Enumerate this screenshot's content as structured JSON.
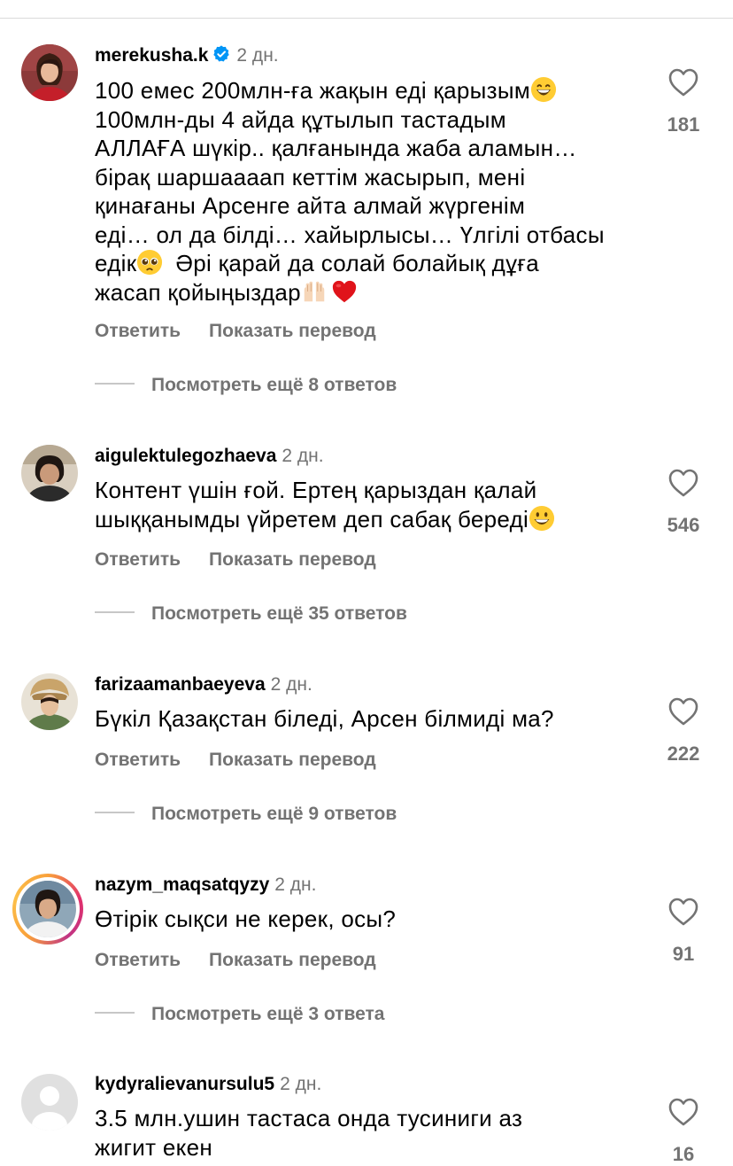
{
  "comments": [
    {
      "username": "merekusha.k",
      "verified": true,
      "time": "2 дн.",
      "lines": [
        "100 емес 200млн-ға жақын еді қарызым",
        "100млн-ды 4 айда құтылып тастадым",
        "АЛЛАҒА шүкір.. қалғанында жаба аламын…",
        "бірақ шаршаааап кеттім жасырып, мені",
        "қинағаны Арсенге айта алмай жүргенім",
        "еді… ол да білді… хайырлысы… Үлгілі отбасы",
        "едік",
        "Әрі қарай да солай болайық дұға",
        "жасап қойыңыздар"
      ],
      "emojis": [
        "grinning-face-with-smiling-eyes",
        "pleading-face",
        "raising-hands",
        "red-heart"
      ],
      "reply": "Ответить",
      "translate": "Показать перевод",
      "more_replies": "Посмотреть ещё 8 ответов",
      "likes": "181"
    },
    {
      "username": "aigulektulegozhaeva",
      "verified": false,
      "time": "2 дн.",
      "lines": [
        "Контент үшін ғой. Ертең қарыздан қалай",
        "шыққанымды үйретем деп сабақ береді"
      ],
      "emojis": [
        "grinning-face"
      ],
      "reply": "Ответить",
      "translate": "Показать перевод",
      "more_replies": "Посмотреть ещё 35 ответов",
      "likes": "546"
    },
    {
      "username": "farizaamanbaeyeva",
      "verified": false,
      "time": "2 дн.",
      "lines": [
        "Бүкіл Қазақстан біледі, Арсен білмиді ма?"
      ],
      "reply": "Ответить",
      "translate": "Показать перевод",
      "more_replies": "Посмотреть ещё 9 ответов",
      "likes": "222"
    },
    {
      "username": "nazym_maqsatqyzy",
      "verified": false,
      "has_story_ring": true,
      "time": "2 дн.",
      "lines": [
        "Өтірік сықси не керек, осы?"
      ],
      "reply": "Ответить",
      "translate": "Показать перевод",
      "more_replies": "Посмотреть ещё 3 ответа",
      "likes": "91"
    },
    {
      "username": "kydyralievanursulu5",
      "verified": false,
      "time": "2 дн.",
      "lines": [
        "3.5 млн.ушин тастаса онда тусиниги аз",
        "жигит екен"
      ],
      "likes": "16"
    }
  ],
  "colors": {
    "text": "#000000",
    "secondary": "#737373",
    "verified_badge": "#0095f6",
    "divider": "#dbdbdb"
  }
}
